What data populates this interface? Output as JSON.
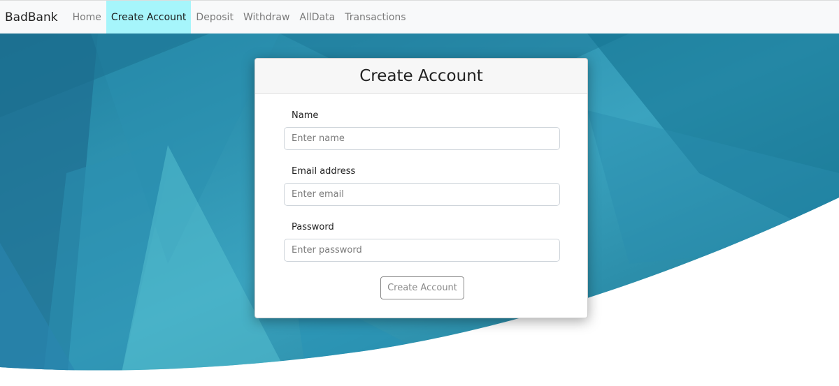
{
  "navbar": {
    "brand": "BadBank",
    "items": [
      {
        "label": "Home",
        "active": false
      },
      {
        "label": "Create Account",
        "active": true
      },
      {
        "label": "Deposit",
        "active": false
      },
      {
        "label": "Withdraw",
        "active": false
      },
      {
        "label": "AllData",
        "active": false
      },
      {
        "label": "Transactions",
        "active": false
      }
    ],
    "active_color": "#a6f5fb"
  },
  "card": {
    "title": "Create Account",
    "fields": [
      {
        "label": "Name",
        "placeholder": "Enter name",
        "value": ""
      },
      {
        "label": "Email address",
        "placeholder": "Enter email",
        "value": ""
      },
      {
        "label": "Password",
        "placeholder": "Enter password",
        "value": ""
      }
    ],
    "submit_label": "Create Account"
  },
  "colors": {
    "hero_dark": "#166f8c",
    "hero_light": "#4ab7c9"
  }
}
